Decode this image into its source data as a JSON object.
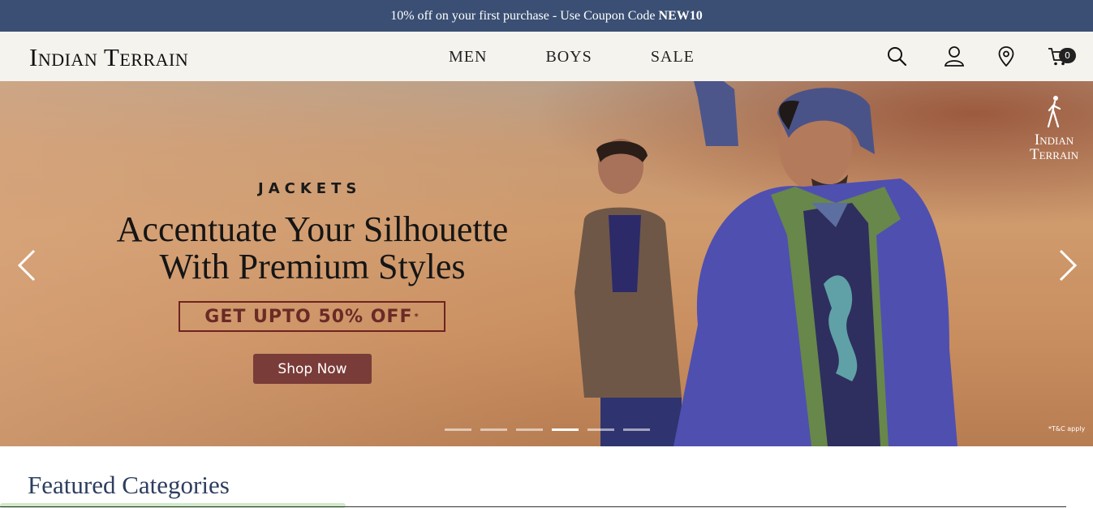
{
  "promo": {
    "text": "10% off on your first purchase - Use Coupon Code",
    "code": "NEW10"
  },
  "header": {
    "logo": "Indian Terrain",
    "nav": [
      {
        "label": "MEN"
      },
      {
        "label": "BOYS"
      },
      {
        "label": "SALE"
      }
    ],
    "cart_count": "0",
    "icons": [
      "search-icon",
      "user-icon",
      "location-pin-icon",
      "cart-icon"
    ]
  },
  "hero": {
    "eyebrow": "JACKETS",
    "headline_line1": "Accentuate Your Silhouette",
    "headline_line2": "With Premium Styles",
    "offer": "GET UPTO 50% OFF",
    "offer_mark": "*",
    "cta": "Shop Now",
    "brand_line1": "Indian",
    "brand_line2": "Terrain",
    "tnc": "*T&C apply",
    "slides_total": 6,
    "active_slide": 4
  },
  "featured": {
    "title": "Featured Categories"
  },
  "colors": {
    "promo_bg": "#3a4f73",
    "header_bg": "#f5f3ee",
    "cta_bg": "#7a3c38",
    "heading": "#2d3e5e"
  }
}
